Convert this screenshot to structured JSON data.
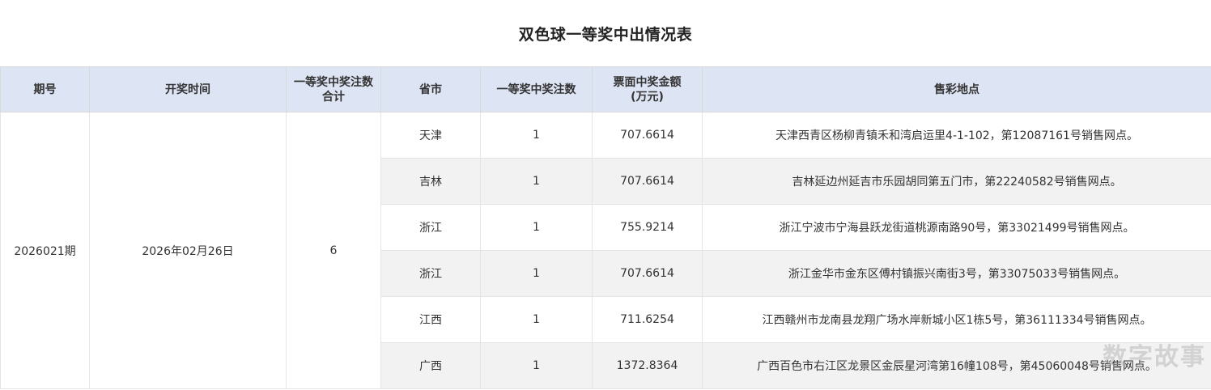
{
  "title": "双色球一等奖中出情况表",
  "headers": {
    "issue": "期号",
    "draw_time": "开奖时间",
    "total_count_line1": "一等奖中奖注数",
    "total_count_line2": "合计",
    "province": "省市",
    "count": "一等奖中奖注数",
    "amount_line1": "票面中奖金额",
    "amount_line2": "(万元)",
    "location": "售彩地点"
  },
  "summary": {
    "issue": "2026021期",
    "draw_time": "2026年02月26日",
    "total_count": "6"
  },
  "rows": [
    {
      "province": "天津",
      "count": "1",
      "amount": "707.6614",
      "location": "天津西青区杨柳青镇禾和湾启运里4-1-102，第12087161号销售网点。"
    },
    {
      "province": "吉林",
      "count": "1",
      "amount": "707.6614",
      "location": "吉林延边州延吉市乐园胡同第五门市，第22240582号销售网点。"
    },
    {
      "province": "浙江",
      "count": "1",
      "amount": "755.9214",
      "location": "浙江宁波市宁海县跃龙街道桃源南路90号，第33021499号销售网点。"
    },
    {
      "province": "浙江",
      "count": "1",
      "amount": "707.6614",
      "location": "浙江金华市金东区傅村镇振兴南街3号，第33075033号销售网点。"
    },
    {
      "province": "江西",
      "count": "1",
      "amount": "711.6254",
      "location": "江西赣州市龙南县龙翔广场水岸新城小区1栋5号，第36111334号销售网点。"
    },
    {
      "province": "广西",
      "count": "1",
      "amount": "1372.8364",
      "location": "广西百色市右江区龙景区金辰星河湾第16幢108号，第45060048号销售网点。"
    }
  ],
  "watermark": "数字故事"
}
